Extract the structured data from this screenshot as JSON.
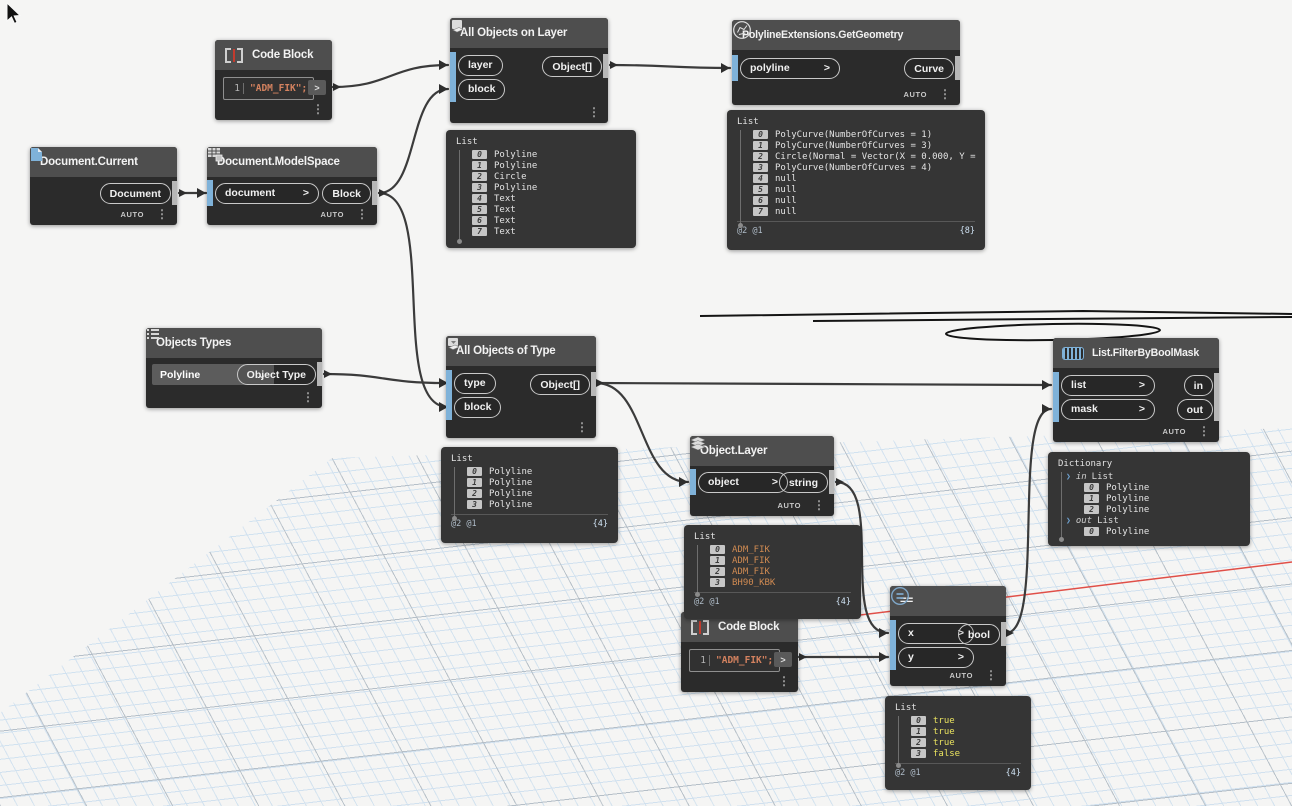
{
  "ui": {
    "chevron": ">",
    "auto_label": "AUTO"
  },
  "nodes": {
    "code_top": {
      "title": "Code Block",
      "line": "1",
      "code": "\"ADM_FIK\";"
    },
    "on_layer": {
      "title": "All Objects on Layer",
      "inputs": [
        "layer",
        "block"
      ],
      "output": "Object[]"
    },
    "get_geometry": {
      "title": "PolylineExtensions.GetGeometry",
      "input": "polyline",
      "output": "Curve"
    },
    "doc_current": {
      "title": "Document.Current",
      "output": "Document"
    },
    "doc_modelspace": {
      "title": "Document.ModelSpace",
      "input": "document",
      "output": "Block"
    },
    "objects_types": {
      "title": "Objects Types",
      "selected": "Polyline",
      "output": "Object Type"
    },
    "of_type": {
      "title": "All Objects of Type",
      "inputs": [
        "type",
        "block"
      ],
      "output": "Object[]"
    },
    "object_layer": {
      "title": "Object.Layer",
      "input": "object",
      "output": "string"
    },
    "code_bottom": {
      "title": "Code Block",
      "line": "1",
      "code": "\"ADM_FIK\";"
    },
    "equals": {
      "title": "==",
      "inputs": [
        "x",
        "y"
      ],
      "output": "bool"
    },
    "filter": {
      "title": "List.FilterByBoolMask",
      "inputs": [
        "list",
        "mask"
      ],
      "outputs": [
        "in",
        "out"
      ]
    }
  },
  "bubbles": {
    "on_layer": {
      "title": "List",
      "items": [
        {
          "i": "0",
          "v": "Polyline"
        },
        {
          "i": "1",
          "v": "Polyline"
        },
        {
          "i": "2",
          "v": "Circle"
        },
        {
          "i": "3",
          "v": "Polyline"
        },
        {
          "i": "4",
          "v": "Text"
        },
        {
          "i": "5",
          "v": "Text"
        },
        {
          "i": "6",
          "v": "Text"
        },
        {
          "i": "7",
          "v": "Text"
        }
      ]
    },
    "geometry": {
      "title": "List",
      "items": [
        {
          "i": "0",
          "v": "PolyCurve(NumberOfCurves = 1)"
        },
        {
          "i": "1",
          "v": "PolyCurve(NumberOfCurves = 3)"
        },
        {
          "i": "2",
          "v": "Circle(Normal = Vector(X = 0.000, Y ="
        },
        {
          "i": "3",
          "v": "PolyCurve(NumberOfCurves = 4)"
        },
        {
          "i": "4",
          "v": "null"
        },
        {
          "i": "5",
          "v": "null"
        },
        {
          "i": "6",
          "v": "null"
        },
        {
          "i": "7",
          "v": "null"
        }
      ],
      "levels": "@2 @1",
      "count": "{8}"
    },
    "of_type": {
      "title": "List",
      "items": [
        {
          "i": "0",
          "v": "Polyline"
        },
        {
          "i": "1",
          "v": "Polyline"
        },
        {
          "i": "2",
          "v": "Polyline"
        },
        {
          "i": "3",
          "v": "Polyline"
        }
      ],
      "levels": "@2 @1",
      "count": "{4}"
    },
    "layers": {
      "title": "List",
      "items": [
        {
          "i": "0",
          "v": "ADM_FIK"
        },
        {
          "i": "1",
          "v": "ADM_FIK"
        },
        {
          "i": "2",
          "v": "ADM_FIK"
        },
        {
          "i": "3",
          "v": "BH90_KBK"
        }
      ],
      "levels": "@2 @1",
      "count": "{4}"
    },
    "bools": {
      "title": "List",
      "items": [
        {
          "i": "0",
          "v": "true"
        },
        {
          "i": "1",
          "v": "true"
        },
        {
          "i": "2",
          "v": "true"
        },
        {
          "i": "3",
          "v": "false"
        }
      ],
      "levels": "@2 @1",
      "count": "{4}"
    },
    "dict": {
      "title": "Dictionary",
      "groups": [
        {
          "key": "in",
          "type": "List",
          "items": [
            {
              "i": "0",
              "v": "Polyline"
            },
            {
              "i": "1",
              "v": "Polyline"
            },
            {
              "i": "2",
              "v": "Polyline"
            }
          ]
        },
        {
          "key": "out",
          "type": "List",
          "items": [
            {
              "i": "0",
              "v": "Polyline"
            }
          ]
        }
      ]
    }
  },
  "colors": {
    "accent_blue": "#7fb2d9",
    "wire": "#3b3b3b",
    "axis_red": "#e04f48",
    "string_value": "#cf8a52",
    "bool_value": "#e9e25f",
    "node_header": "#4e4e4e",
    "node_body": "#2b2b2b",
    "canvas": "#f5f5f4"
  }
}
